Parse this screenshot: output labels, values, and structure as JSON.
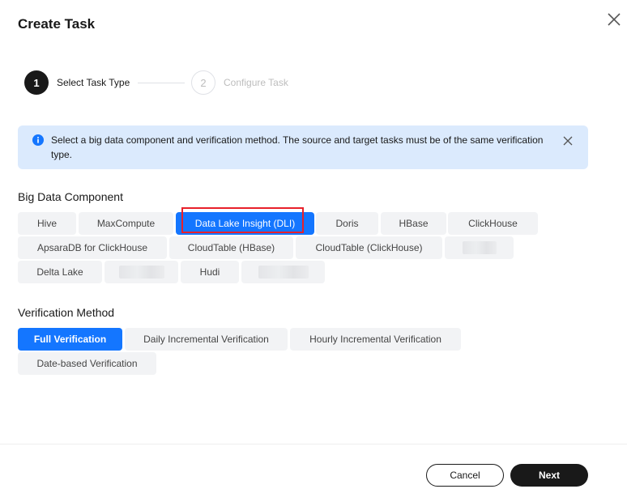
{
  "dialog": {
    "title": "Create Task"
  },
  "steps": [
    {
      "number": "1",
      "label": "Select Task Type",
      "state": "active"
    },
    {
      "number": "2",
      "label": "Configure Task",
      "state": "inactive"
    }
  ],
  "alert": {
    "text": "Select a big data component and verification method. The source and target tasks must be of the same verification type.",
    "icon": "info-icon"
  },
  "big_data_component": {
    "title": "Big Data Component",
    "options": [
      "Hive",
      "MaxCompute",
      "Data Lake Insight (DLI)",
      "Doris",
      "HBase",
      "ClickHouse",
      "ApsaraDB for ClickHouse",
      "CloudTable (HBase)",
      "CloudTable (ClickHouse)",
      "Delta Lake",
      "Hudi"
    ],
    "selected": "Data Lake Insight (DLI)"
  },
  "verification_method": {
    "title": "Verification Method",
    "options": [
      "Full Verification",
      "Daily Incremental Verification",
      "Hourly Incremental Verification",
      "Date-based Verification"
    ],
    "selected": "Full Verification"
  },
  "footer": {
    "cancel_label": "Cancel",
    "next_label": "Next"
  },
  "colors": {
    "accent": "#1476ff",
    "alert_bg": "#dbeafd",
    "highlight": "#e8202a",
    "dark": "#191919"
  }
}
